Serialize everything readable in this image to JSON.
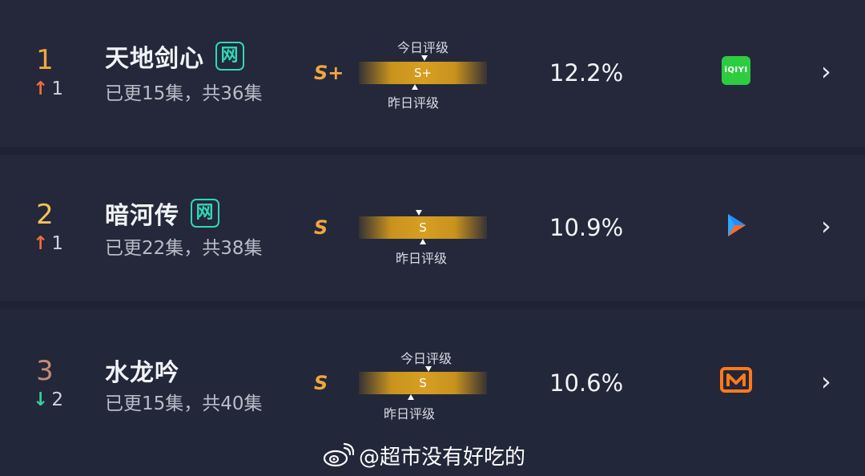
{
  "rows": [
    {
      "rank": "1",
      "change": "1",
      "direction": "up",
      "title": "天地剑心",
      "badge": "网",
      "episodes": "已更15集，共36集",
      "grade": "S+",
      "bar_grade": "S+",
      "today_label": "今日评级",
      "yesterday_label": "昨日评级",
      "share": "12.2%",
      "platform": "iqiyi-logo",
      "platform_text": "iQIYI"
    },
    {
      "rank": "2",
      "change": "1",
      "direction": "up",
      "title": "暗河传",
      "badge": "网",
      "episodes": "已更22集，共38集",
      "grade": "S",
      "bar_grade": "S",
      "yesterday_label": "昨日评级",
      "share": "10.9%",
      "platform": "youku-logo"
    },
    {
      "rank": "3",
      "change": "2",
      "direction": "down",
      "title": "水龙吟",
      "episodes": "已更15集，共40集",
      "grade": "S",
      "bar_grade": "S",
      "today_label": "今日评级",
      "yesterday_label": "昨日评级",
      "share": "10.6%",
      "platform": "mgtv-logo"
    }
  ],
  "watermark": {
    "text": "@超市没有好吃的",
    "icon": "weibo-icon"
  },
  "colors": {
    "background": "#1e2232",
    "row": "#24283a",
    "accent_gold": "#f0a640",
    "badge_teal": "#2ed9b6",
    "up_arrow": "#f26b3a",
    "down_arrow": "#35d0a0"
  }
}
